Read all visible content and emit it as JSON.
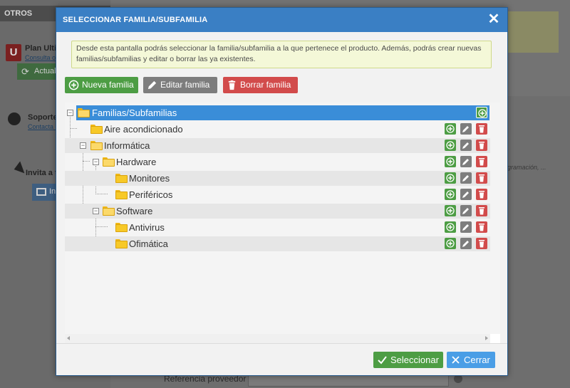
{
  "background": {
    "sidebar_header": "OTROS",
    "logo_letter": "U",
    "plan_title": "Plan Ultir",
    "plan_link": "Consulta of",
    "update_button": "Actual",
    "support_title": "Soporte",
    "support_link": "Contacta c",
    "invite_title": "Invita a t",
    "invite_button": "In",
    "side_text": "gramación, ...",
    "ref_label": "Referencia proveedor"
  },
  "modal": {
    "title": "SELECCIONAR FAMILIA/SUBFAMILIA",
    "close_glyph": "✕",
    "info": "Desde esta pantalla podrás seleccionar la familia/subfamilia a la que pertenece el producto. Además, podrás crear nuevas familias/subfamilias y editar o borrar las ya existentes.",
    "toolbar": {
      "new_label": "Nueva familia",
      "edit_label": "Editar familia",
      "delete_label": "Borrar familia"
    },
    "tree": [
      {
        "label": "Familias/Subfamilias",
        "level": 0,
        "selected": true
      },
      {
        "label": "Aire acondicionado",
        "level": 1
      },
      {
        "label": "Informática",
        "level": 1
      },
      {
        "label": "Hardware",
        "level": 2
      },
      {
        "label": "Monitores",
        "level": 3
      },
      {
        "label": "Periféricos",
        "level": 3
      },
      {
        "label": "Software",
        "level": 2
      },
      {
        "label": "Antivirus",
        "level": 3
      },
      {
        "label": "Ofimática",
        "level": 3
      }
    ],
    "footer": {
      "select_label": "Seleccionar",
      "close_label": "Cerrar"
    }
  },
  "colors": {
    "header_blue": "#3a7fc4",
    "selected_row": "#3a8dd8",
    "green": "#4d9d44",
    "grey": "#7d7d7d",
    "red": "#d24b4b",
    "light_blue": "#4a9ee6",
    "info_bg": "#f4f8d8",
    "folder": "#f7c928"
  }
}
